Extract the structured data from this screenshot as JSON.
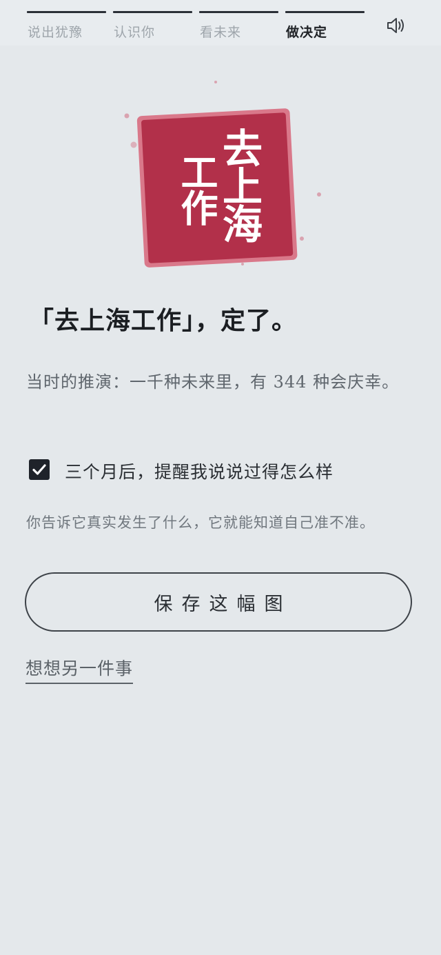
{
  "steps": [
    {
      "label": "说出犹豫",
      "active": false
    },
    {
      "label": "认识你",
      "active": false
    },
    {
      "label": "看未来",
      "active": false
    },
    {
      "label": "做决定",
      "active": true
    }
  ],
  "sound_icon": "speaker-icon",
  "stamp": {
    "col1": "去上海",
    "col2": "工作",
    "color": "#b3304a",
    "border_color": "#d06b7e"
  },
  "headline": "「去上海工作」，定了。",
  "description": "当时的推演：一千种未来里，有 344 种会庆幸。",
  "reminder": {
    "checked": true,
    "label": "三个月后，提醒我说说过得怎么样"
  },
  "note": "你告诉它真实发生了什么，它就能知道自己准不准。",
  "save_button": "保存这幅图",
  "alt_link": "想想另一件事",
  "colors": {
    "background": "#e4e8eb",
    "text_dark": "#1f2226",
    "text_muted": "#5f666d",
    "accent": "#b3304a"
  }
}
